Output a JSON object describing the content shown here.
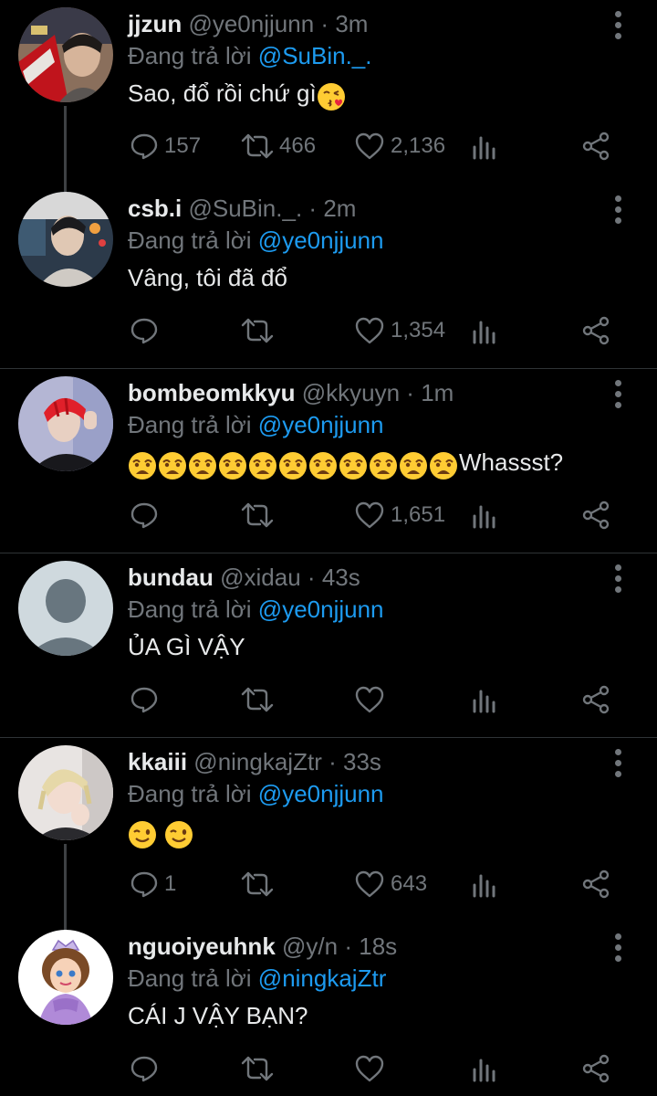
{
  "theme": {
    "background": "#000000",
    "text": "#e7e9ea",
    "muted": "#71767b",
    "link": "#1d9bf0",
    "divider": "#2f3336"
  },
  "tweets": [
    {
      "name": "jjzun",
      "handle": "@ye0njjunn",
      "dot": "·",
      "time": "3m",
      "replying_prefix": "Đang trả lời",
      "replying_to": "@SuBin._.",
      "text": "Sao, đổ rồi chứ gì",
      "emoji": [
        "kissing-heart-face"
      ],
      "replies": "157",
      "retweets": "466",
      "likes": "2,136",
      "avatar": "photo-boy-with-red-car"
    },
    {
      "name": "csb.i",
      "handle": "@SuBin._.",
      "dot": "·",
      "time": "2m",
      "replying_prefix": "Đang trả lời",
      "replying_to": "@ye0njjunn",
      "text": "Vâng, tôi đã đổ",
      "emoji": [],
      "replies": "",
      "retweets": "",
      "likes": "1,354",
      "avatar": "photo-boy-city-night"
    },
    {
      "name": "bombeomkkyu",
      "handle": "@kkyuyn",
      "dot": "·",
      "time": "1m",
      "replying_prefix": "Đang trả lời",
      "replying_to": "@ye0njjunn",
      "text": "Whassst?",
      "emoji": [
        "weary-face",
        "weary-face",
        "weary-face",
        "weary-face",
        "weary-face",
        "weary-face",
        "weary-face",
        "weary-face",
        "weary-face",
        "weary-face",
        "weary-face"
      ],
      "replies": "",
      "retweets": "",
      "likes": "1,651",
      "avatar": "photo-red-hair-boy"
    },
    {
      "name": "bundau",
      "handle": "@xidau",
      "dot": "·",
      "time": "43s",
      "replying_prefix": "Đang trả lời",
      "replying_to": "@ye0njjunn",
      "text": "ỦA GÌ VẬY",
      "emoji": [],
      "replies": "",
      "retweets": "",
      "likes": "",
      "avatar": "default-avatar"
    },
    {
      "name": "kkaiii",
      "handle": "@ningkajZtr",
      "dot": "·",
      "time": "33s",
      "replying_prefix": "Đang trả lời",
      "replying_to": "@ye0njjunn",
      "text": "",
      "emoji": [
        "winking-face",
        "winking-face"
      ],
      "replies": "1",
      "retweets": "",
      "likes": "643",
      "avatar": "photo-blonde-boy"
    },
    {
      "name": "nguoiyeuhnk",
      "handle": "@y/n",
      "dot": "·",
      "time": "18s",
      "replying_prefix": "Đang trả lời",
      "replying_to": "@ningkajZtr",
      "text": "CÁI J VẬY BẠN?",
      "emoji": [],
      "replies": "",
      "retweets": "",
      "likes": "",
      "avatar": "cartoon-princess"
    }
  ]
}
